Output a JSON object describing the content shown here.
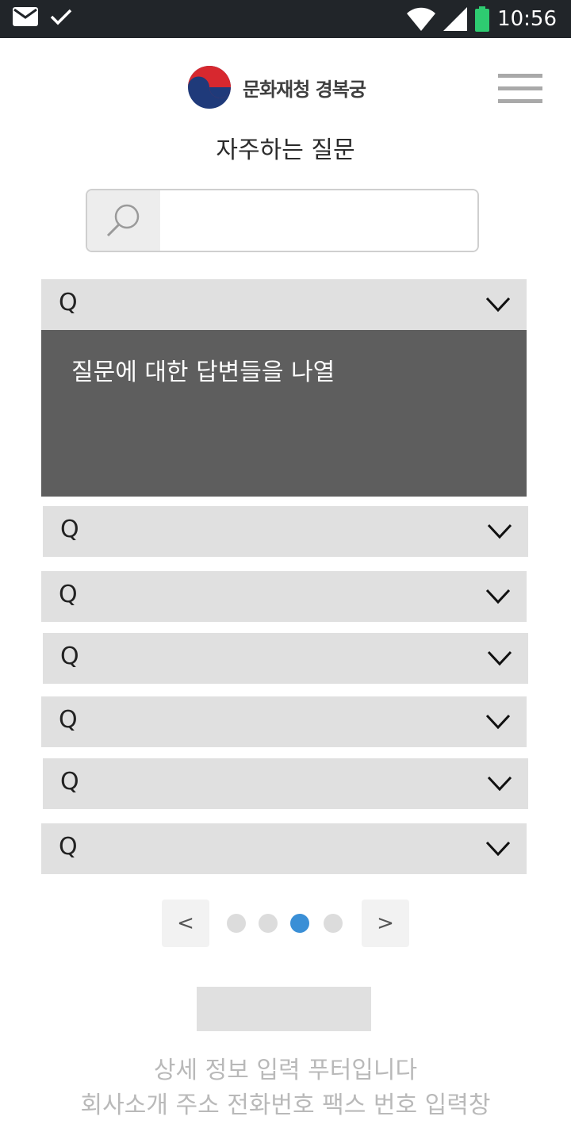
{
  "status_bar": {
    "time": "10:56",
    "left_icons": [
      "mail-icon",
      "check-icon"
    ],
    "right_icons": [
      "wifi-icon",
      "signal-icon",
      "battery-icon"
    ],
    "battery_color": "#2ecc71"
  },
  "header": {
    "logo_text": "문화재청 경복궁",
    "menu_icon": "hamburger-icon"
  },
  "page": {
    "title": "자주하는 질문"
  },
  "search": {
    "icon": "search-icon",
    "value": "",
    "placeholder": ""
  },
  "faq": {
    "items": [
      {
        "label": "Q",
        "expanded": true
      },
      {
        "label": "Q",
        "expanded": false
      },
      {
        "label": "Q",
        "expanded": false
      },
      {
        "label": "Q",
        "expanded": false
      },
      {
        "label": "Q",
        "expanded": false
      },
      {
        "label": "Q",
        "expanded": false
      },
      {
        "label": "Q",
        "expanded": false
      }
    ],
    "answer_text": "질문에 대한 답변들을 나열"
  },
  "pagination": {
    "prev_label": "<",
    "next_label": ">",
    "page_count": 4,
    "current_page": 3,
    "active_color": "#3a8fd6"
  },
  "footer": {
    "line1": "상세 정보 입력 푸터입니다",
    "line2": "회사소개 주소 전화번호 팩스 번호 입력창"
  }
}
